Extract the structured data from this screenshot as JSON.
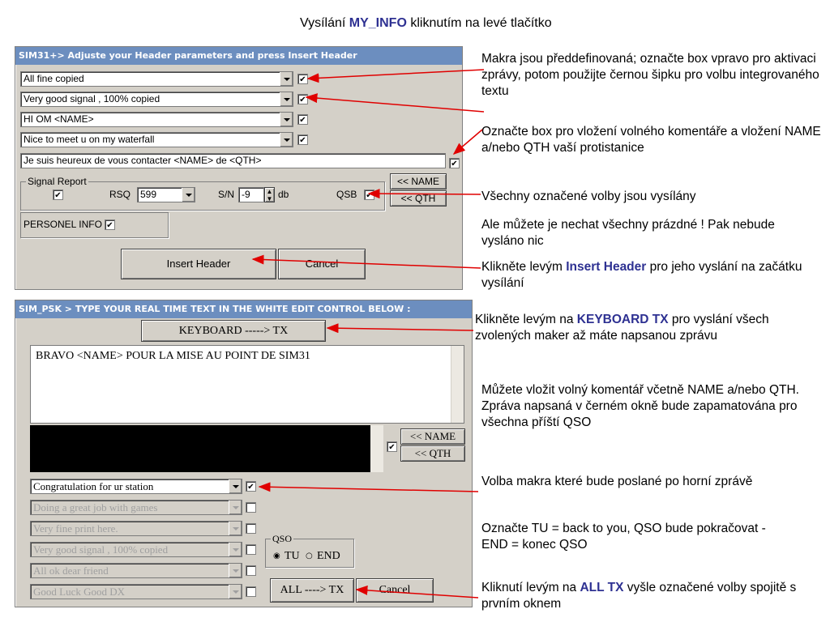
{
  "slide": {
    "title_pre": "Vysílání ",
    "title_hl": "MY_INFO",
    "title_post": " kliknutím na levé tlačítko"
  },
  "header_window": {
    "title": "SIM31+> Adjuste your Header parameters and press Insert Header",
    "macros": [
      {
        "value": "All fine copied",
        "checked": true
      },
      {
        "value": "Very good signal , 100% copied",
        "checked": true
      },
      {
        "value": "HI OM <NAME>",
        "checked": true
      },
      {
        "value": "Nice to meet u on my waterfall",
        "checked": true
      }
    ],
    "comment_value": "Je suis heureux de vous contacter <NAME> de <QTH>",
    "signal_report_label": "Signal Report",
    "rsq_label": "RSQ",
    "rsq_value": "599",
    "sn_label": "S/N",
    "sn_value": "-9",
    "db_label": "db",
    "qsb_label": "QSB",
    "name_btn": "<< NAME",
    "qth_btn": "<< QTH",
    "personal_info_label": "PERSONEL INFO",
    "insert_header_btn": "Insert Header",
    "cancel_btn": "Cancel"
  },
  "psk_window": {
    "title": "SIM_PSK > TYPE YOUR REAL TIME TEXT IN THE WHITE EDIT CONTROL BELOW :",
    "keyboard_tx_btn": "KEYBOARD -----> TX",
    "edit_text": "BRAVO <NAME> POUR LA MISE AU POINT DE SIM31",
    "name_btn": "<< NAME",
    "qth_btn": "<< QTH",
    "macros": [
      {
        "value": "Congratulation for ur station",
        "enabled": true,
        "checked": true
      },
      {
        "value": "Doing a great job with games",
        "enabled": false,
        "checked": false
      },
      {
        "value": "Very fine print here.",
        "enabled": false,
        "checked": false
      },
      {
        "value": "Very good signal , 100% copied",
        "enabled": false,
        "checked": false
      },
      {
        "value": "All ok dear friend",
        "enabled": false,
        "checked": false
      },
      {
        "value": "Good Luck Good DX",
        "enabled": false,
        "checked": false
      }
    ],
    "qso_group_label": "QSO",
    "qso_tu": "TU",
    "qso_end": "END",
    "qso_selected": "TU",
    "all_tx_btn": "ALL ----> TX",
    "cancel_btn": "Cancel"
  },
  "notes": {
    "n1": "Makra jsou předdefinovaná; označte box vpravo pro aktivaci zprávy, potom použijte černou šipku pro volbu integrovaného textu",
    "n2": "Označte box pro vložení volného komentáře a vložení NAME a/nebo QTH vaší protistanice",
    "n3": "Všechny označené volby jsou vysílány",
    "n4": "Ale můžete je nechat všechny prázdné ! Pak nebude vysláno nic",
    "n5_pre": "Klikněte levým ",
    "n5_hl": "Insert Header",
    "n5_post": " pro jeho vyslání na začátku vysílání",
    "n6_pre": "Klikněte levým na ",
    "n6_hl": "KEYBOARD TX",
    "n6_post": " pro vyslání všech zvolených maker až máte napsanou zprávu",
    "n7": "Můžete vložit volný komentář včetně NAME a/nebo QTH. Zpráva napsaná v černém okně bude zapamatována pro všechna příští QSO",
    "n8": "Volba makra které bude poslané po horní zprávě",
    "n9": "Označte TU = back to you, QSO bude pokračovat - END = konec QSO",
    "n10_pre": "Kliknutí levým na ",
    "n10_hl": "ALL TX",
    "n10_post": " vyšle označené volby spojitě s prvním oknem"
  },
  "colors": {
    "highlight": "#2e3192",
    "arrow": "#e00000",
    "titlebar": "#6c8ebf",
    "window": "#d4d0c8"
  }
}
